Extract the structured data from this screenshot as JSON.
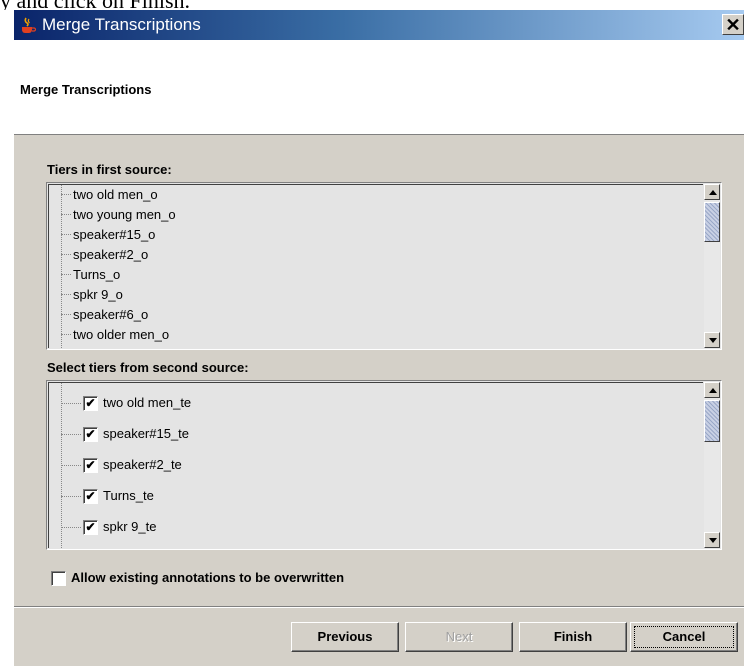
{
  "overlay_caption": "y and click on Finish.",
  "window": {
    "title": "Merge Transcriptions",
    "close_glyph": "✕"
  },
  "header": {
    "title": "Merge Transcriptions"
  },
  "first_source": {
    "label": "Tiers in first source:",
    "items": [
      "two old men_o",
      "two young men_o",
      "speaker#15_o",
      "speaker#2_o",
      "Turns_o",
      "spkr 9_o",
      "speaker#6_o",
      "two older men_o"
    ]
  },
  "second_source": {
    "label": "Select tiers from second source:",
    "items": [
      {
        "label": "two old men_te",
        "checked": true
      },
      {
        "label": "speaker#15_te",
        "checked": true
      },
      {
        "label": "speaker#2_te",
        "checked": true
      },
      {
        "label": "Turns_te",
        "checked": true
      },
      {
        "label": "spkr 9_te",
        "checked": true
      }
    ]
  },
  "options": {
    "allow_overwrite_label": "Allow existing annotations to be overwritten",
    "allow_overwrite_checked": false
  },
  "buttons": {
    "previous": "Previous",
    "next": "Next",
    "finish": "Finish",
    "cancel": "Cancel"
  },
  "icons": {
    "title": "java-cup-icon",
    "close": "close-icon",
    "checkmark": "✔"
  },
  "colors": {
    "titlebar_start": "#0a246a",
    "titlebar_end": "#a6caf0",
    "dialog_bg": "#d4d0c8",
    "list_bg": "#e4e4e4"
  }
}
